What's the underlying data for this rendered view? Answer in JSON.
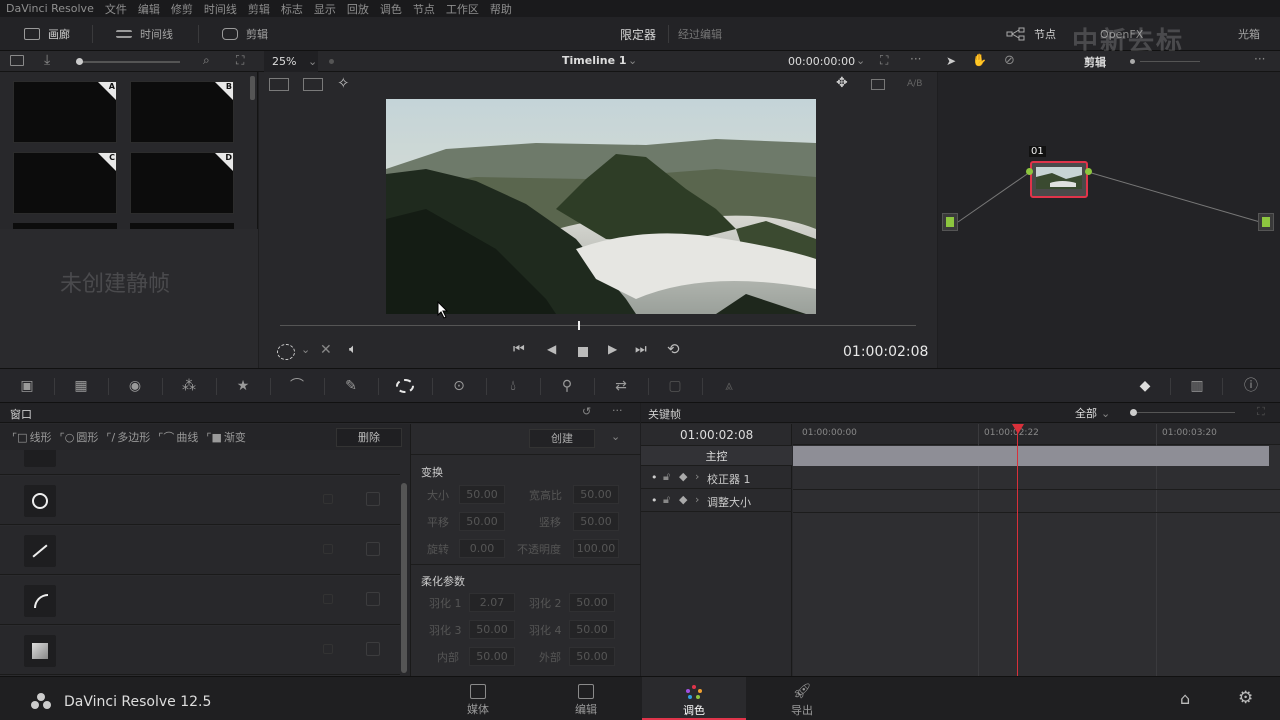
{
  "menu": [
    "DaVinci Resolve",
    "文件",
    "编辑",
    "修剪",
    "时间线",
    "剪辑",
    "标志",
    "显示",
    "回放",
    "调色",
    "节点",
    "工作区",
    "帮助"
  ],
  "toolbar": {
    "gallery": "画廊",
    "timeline": "时间线",
    "clips": "剪辑",
    "limiter": "限定器",
    "bypass": "经过编辑",
    "nodes": "节点",
    "openfx": "OpenFX",
    "lightbox": "光箱",
    "watermark": "中新去标"
  },
  "viewer": {
    "zoom": "25%",
    "timeline_name": "Timeline 1",
    "timecode_top": "00:00:00:00",
    "ab": "A/B",
    "timecode": "01:00:02:08"
  },
  "gallery": {
    "empty": "未创建静帧",
    "labels": [
      "A",
      "B",
      "C",
      "D"
    ]
  },
  "node_panel": {
    "mode": "剪辑",
    "node_label": "01"
  },
  "window_panel": {
    "title": "窗口",
    "tools": [
      "线形",
      "圆形",
      "多边形",
      "曲线",
      "渐变"
    ],
    "delete": "删除",
    "create": "创建"
  },
  "transform": {
    "title": "变换",
    "size_l": "大小",
    "size_v": "50.00",
    "aspect_l": "宽高比",
    "aspect_v": "50.00",
    "pan_l": "平移",
    "pan_v": "50.00",
    "tilt_l": "竖移",
    "tilt_v": "50.00",
    "rot_l": "旋转",
    "rot_v": "0.00",
    "opacity_l": "不透明度",
    "opacity_v": "100.00"
  },
  "softness": {
    "title": "柔化参数",
    "s1_l": "羽化 1",
    "s1_v": "2.07",
    "s2_l": "羽化 2",
    "s2_v": "50.00",
    "s3_l": "羽化 3",
    "s3_v": "50.00",
    "s4_l": "羽化 4",
    "s4_v": "50.00",
    "in_l": "内部",
    "in_v": "50.00",
    "out_l": "外部",
    "out_v": "50.00"
  },
  "keyframes": {
    "title": "关键帧",
    "filter": "全部",
    "timecode": "01:00:02:08",
    "ruler": [
      "01:00:00:00",
      "01:00:02:22",
      "01:00:03:20"
    ],
    "master": "主控",
    "tracks": [
      "校正器 1",
      "调整大小"
    ]
  },
  "bottom": {
    "app": "DaVinci Resolve 12.5",
    "pages": [
      "媒体",
      "编辑",
      "调色",
      "导出"
    ]
  },
  "colors": {
    "accent": "#e0344a",
    "node_green": "#8dc63f",
    "playhead": "#d8303a"
  }
}
